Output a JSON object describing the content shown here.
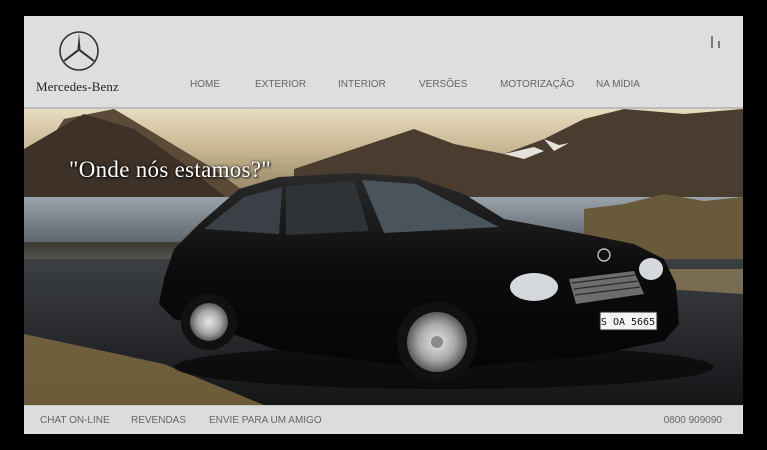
{
  "brand": {
    "name": "Mercedes-Benz"
  },
  "nav": {
    "items": [
      {
        "label": "HOME"
      },
      {
        "label": "EXTERIOR"
      },
      {
        "label": "INTERIOR"
      },
      {
        "label": "VERSÕES"
      },
      {
        "label": "MOTORIZAÇÃO"
      },
      {
        "label": "NA MÍDIA"
      }
    ]
  },
  "hero": {
    "headline": "\"Onde nós estamos?\"",
    "license_plate": "S OA 5665"
  },
  "footer": {
    "links": [
      {
        "label": "CHAT ON-LINE"
      },
      {
        "label": "REVENDAS"
      },
      {
        "label": "ENVIE PARA UM AMIGO"
      }
    ],
    "phone": "0800 909090"
  },
  "colors": {
    "page_background": "#000000",
    "header_background": "#dedede",
    "nav_text": "#666666"
  }
}
